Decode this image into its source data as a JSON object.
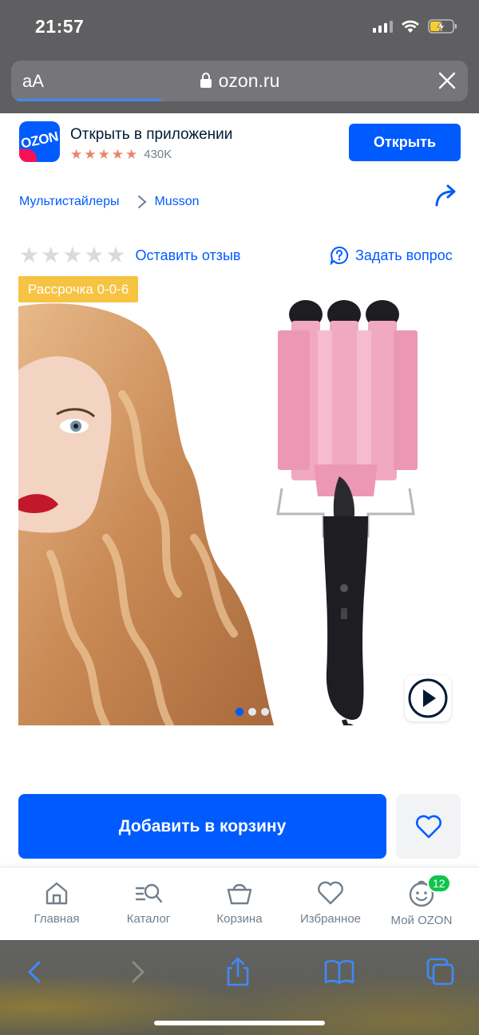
{
  "status": {
    "time": "21:57"
  },
  "browser": {
    "aa_label": "aA",
    "url": "ozon.ru"
  },
  "banner": {
    "title": "Открыть в приложении",
    "rating_stars": 5,
    "review_count": "430K",
    "open_label": "Открыть",
    "logo_text": "OZON"
  },
  "breadcrumb": [
    "Мультистайлеры",
    "Musson"
  ],
  "rating": {
    "stars": 0,
    "review_link": "Оставить отзыв",
    "ask_question": "Задать вопрос"
  },
  "gallery": {
    "promo_badge": "Рассрочка 0-0-6",
    "image_count": 3,
    "active_image": 1
  },
  "actions": {
    "add_to_cart": "Добавить в корзину"
  },
  "tabbar": {
    "items": [
      {
        "label": "Главная",
        "icon": "home-icon"
      },
      {
        "label": "Каталог",
        "icon": "catalog-search-icon"
      },
      {
        "label": "Корзина",
        "icon": "cart-basket-icon"
      },
      {
        "label": "Избранное",
        "icon": "heart-icon"
      },
      {
        "label": "Мой OZON",
        "icon": "smiley-profile-icon",
        "badge": "12"
      }
    ]
  },
  "colors": {
    "brand": "#005bff",
    "promo": "#f6c343",
    "badge": "#10c44c",
    "star": "#e9856a"
  }
}
